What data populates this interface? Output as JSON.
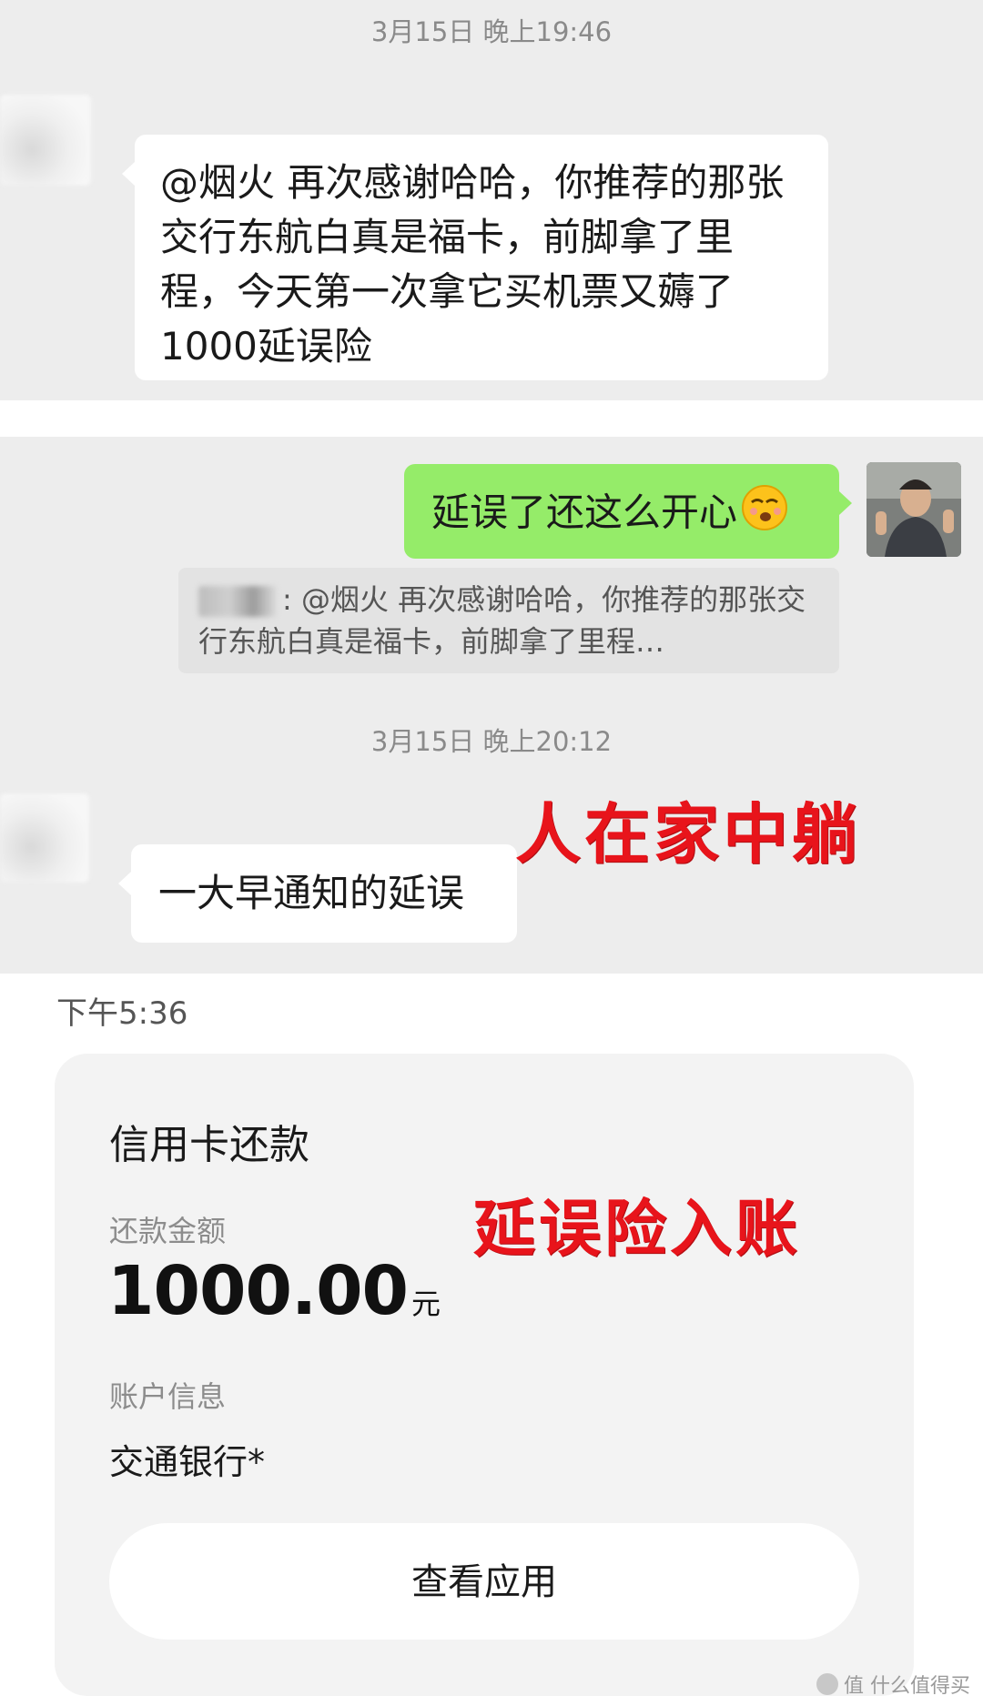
{
  "chat": {
    "timestamp1": "3月15日 晚上19:46",
    "msg1": "@烟火  再次感谢哈哈，你推荐的那张交行东航白真是福卡，前脚拿了里程，今天第一次拿它买机票又薅了1000延误险",
    "reply": "延误了还这么开心",
    "reply_emoji": "smirk-emoji-icon",
    "quote_text": ": @烟火 再次感谢哈哈，你推荐的那张交行东航白真是福卡，前脚拿了里程…",
    "timestamp2": "3月15日 晚上20:12",
    "msg2": "一大早通知的延误",
    "annotation1": "人在家中躺"
  },
  "notification": {
    "time": "下午5:36",
    "title": "信用卡还款",
    "amount_label": "还款金额",
    "amount": "1000.00",
    "amount_unit": "元",
    "account_label": "账户信息",
    "account_value": "交通银行*",
    "button_label": "查看应用",
    "annotation2": "延误险入账"
  },
  "watermark": "值 什么值得买",
  "colors": {
    "chat_bg": "#ededed",
    "outgoing_bubble": "#95ec69",
    "annotation_red": "#e8141b"
  }
}
